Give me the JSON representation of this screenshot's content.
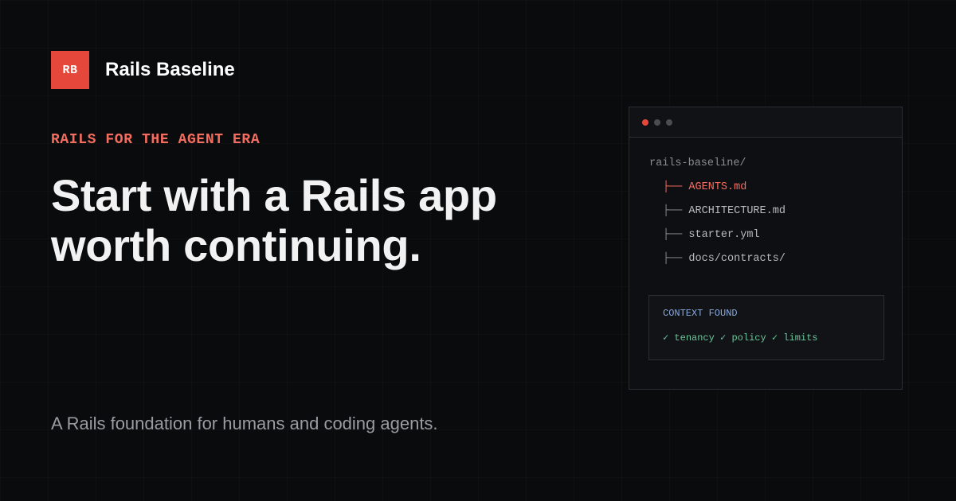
{
  "brand": {
    "logo_text": "RB",
    "name": "Rails Baseline"
  },
  "hero": {
    "eyebrow": "RAILS FOR THE AGENT ERA",
    "headline_line1": "Start with a Rails app",
    "headline_line2": "worth continuing.",
    "subline": "A Rails foundation for humans and coding agents."
  },
  "panel": {
    "root": "rails-baseline/",
    "branch_glyph": "├──",
    "files": [
      {
        "name": "AGENTS.md",
        "active": true
      },
      {
        "name": "ARCHITECTURE.md",
        "active": false
      },
      {
        "name": "starter.yml",
        "active": false
      },
      {
        "name": "docs/contracts/",
        "active": false
      }
    ],
    "context": {
      "title": "CONTEXT FOUND",
      "checks": "✓ tenancy ✓ policy ✓ limits"
    }
  },
  "colors": {
    "background": "#0a0b0d",
    "accent": "#e5483a",
    "accent_text": "#f46d5f",
    "context_title": "#86a8dc",
    "check_green": "#6cc79a"
  }
}
